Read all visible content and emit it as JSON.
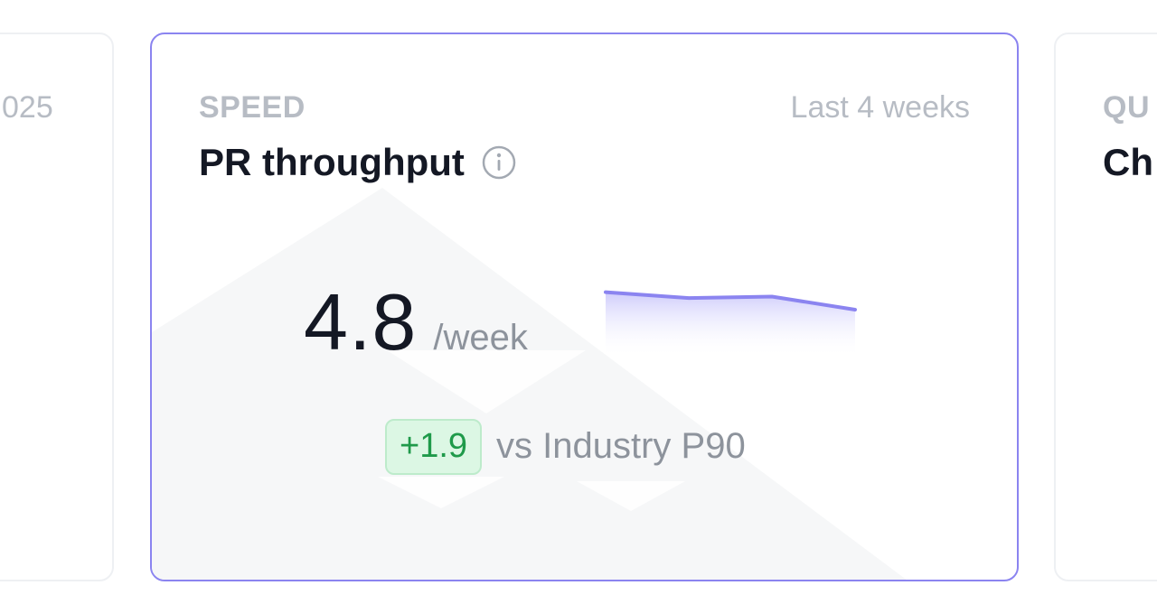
{
  "cards": {
    "left": {
      "partial_text": "025"
    },
    "main": {
      "eyebrow": "SPEED",
      "period": "Last 4 weeks",
      "title": "PR throughput",
      "metric_value": "4.8",
      "metric_unit": "/week",
      "delta": "+1.9",
      "compare_label": "vs Industry P90",
      "sparkline_values": [
        4.9,
        4.7,
        4.75,
        4.3
      ],
      "accent_color": "#8b84f0",
      "positive_color": "#1f9a4a"
    },
    "right": {
      "eyebrow": "QU",
      "title": "Ch"
    }
  },
  "icons": {
    "info": "info-icon"
  }
}
